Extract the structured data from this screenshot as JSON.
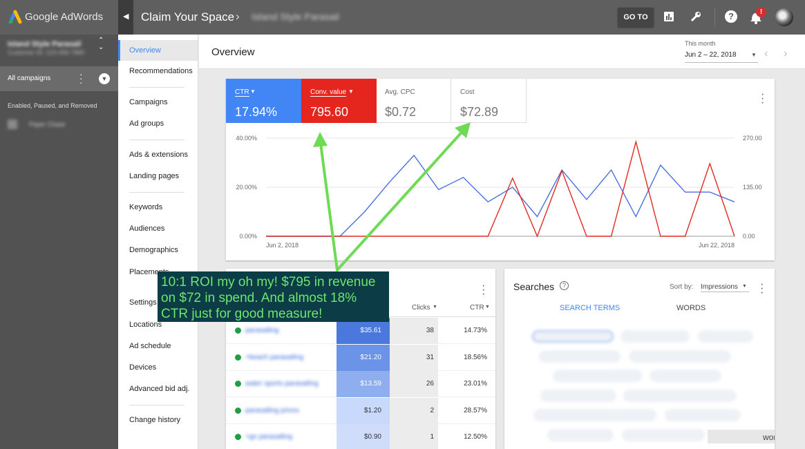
{
  "topbar": {
    "logo_text": "Google AdWords",
    "title": "Claim Your Space",
    "breadcrumb_blurred": "Island Style Parasail",
    "goto_label": "GO TO",
    "notification_count": "!"
  },
  "account": {
    "name_blurred": "Island Style Parasail",
    "id_blurred": "Customer ID: 123-456-7890",
    "all_campaigns": "All campaigns",
    "filter": "Enabled, Paused, and Removed",
    "campaign_blurred": "Paper Chase"
  },
  "nav": {
    "items": [
      "Overview",
      "Recommendations",
      "Campaigns",
      "Ad groups",
      "Ads & extensions",
      "Landing pages",
      "Keywords",
      "Audiences",
      "Demographics",
      "Placements",
      "Settings",
      "Locations",
      "Ad schedule",
      "Devices",
      "Advanced bid adj.",
      "Change history"
    ]
  },
  "header": {
    "title": "Overview",
    "date_caption": "This month",
    "date_range": "Jun 2 – 22, 2018"
  },
  "metrics": [
    {
      "label": "CTR",
      "value": "17.94%",
      "color": "#4285f4"
    },
    {
      "label": "Conv. value",
      "value": "795.60",
      "color": "#e5261f"
    },
    {
      "label": "Avg. CPC",
      "value": "$0.72"
    },
    {
      "label": "Cost",
      "value": "$72.89"
    }
  ],
  "chart_data": {
    "type": "line",
    "x_start": "Jun 2, 2018",
    "x_end": "Jun 22, 2018",
    "left_ticks": [
      "40.00%",
      "20.00%",
      "0.00%"
    ],
    "right_ticks": [
      "270.00",
      "135.00",
      "0.00"
    ],
    "ylim_left": [
      0,
      40
    ],
    "ylim_right": [
      0,
      270
    ],
    "series": [
      {
        "name": "CTR",
        "color": "#4a6fe0",
        "axis": "left",
        "values": [
          0,
          0,
          0,
          0,
          10,
          22,
          33,
          19,
          24,
          14,
          20,
          8,
          27,
          15,
          27,
          8,
          29,
          18,
          18,
          14
        ]
      },
      {
        "name": "Conv. value",
        "color": "#e02a22",
        "axis": "right",
        "values": [
          0,
          0,
          0,
          0,
          0,
          0,
          0,
          0,
          0,
          0,
          160,
          0,
          180,
          0,
          0,
          260,
          0,
          0,
          200,
          0
        ]
      }
    ]
  },
  "keywords": {
    "col_clicks": "Clicks",
    "col_ctr": "CTR",
    "rows": [
      {
        "kw": "parasailing",
        "cost": "$35.61",
        "clicks": "38",
        "ctr": "14.73%",
        "shade": "#4a78dd"
      },
      {
        "kw": "+beach parasailing",
        "cost": "$21.20",
        "clicks": "31",
        "ctr": "18.56%",
        "shade": "#6b93e8"
      },
      {
        "kw": "water sports parasailing",
        "cost": "$13.59",
        "clicks": "26",
        "ctr": "23.01%",
        "shade": "#8eaef0"
      },
      {
        "kw": "parasailing prices",
        "cost": "$1.20",
        "clicks": "2",
        "ctr": "28.57%",
        "shade": "#c9d9fb"
      },
      {
        "kw": "+go parasailing",
        "cost": "$0.90",
        "clicks": "1",
        "ctr": "12.50%",
        "shade": "#cfdcfa"
      }
    ]
  },
  "searches": {
    "title": "Searches",
    "sort_label": "Sort by:",
    "sort_value": "Impressions",
    "tab_terms": "SEARCH TERMS",
    "tab_words": "WORDS",
    "footer_text": "words"
  },
  "annotation": {
    "text": "10:1 ROI my oh my! $795 in revenue on $72 in spend. And almost 18% CTR just for good measure!"
  }
}
